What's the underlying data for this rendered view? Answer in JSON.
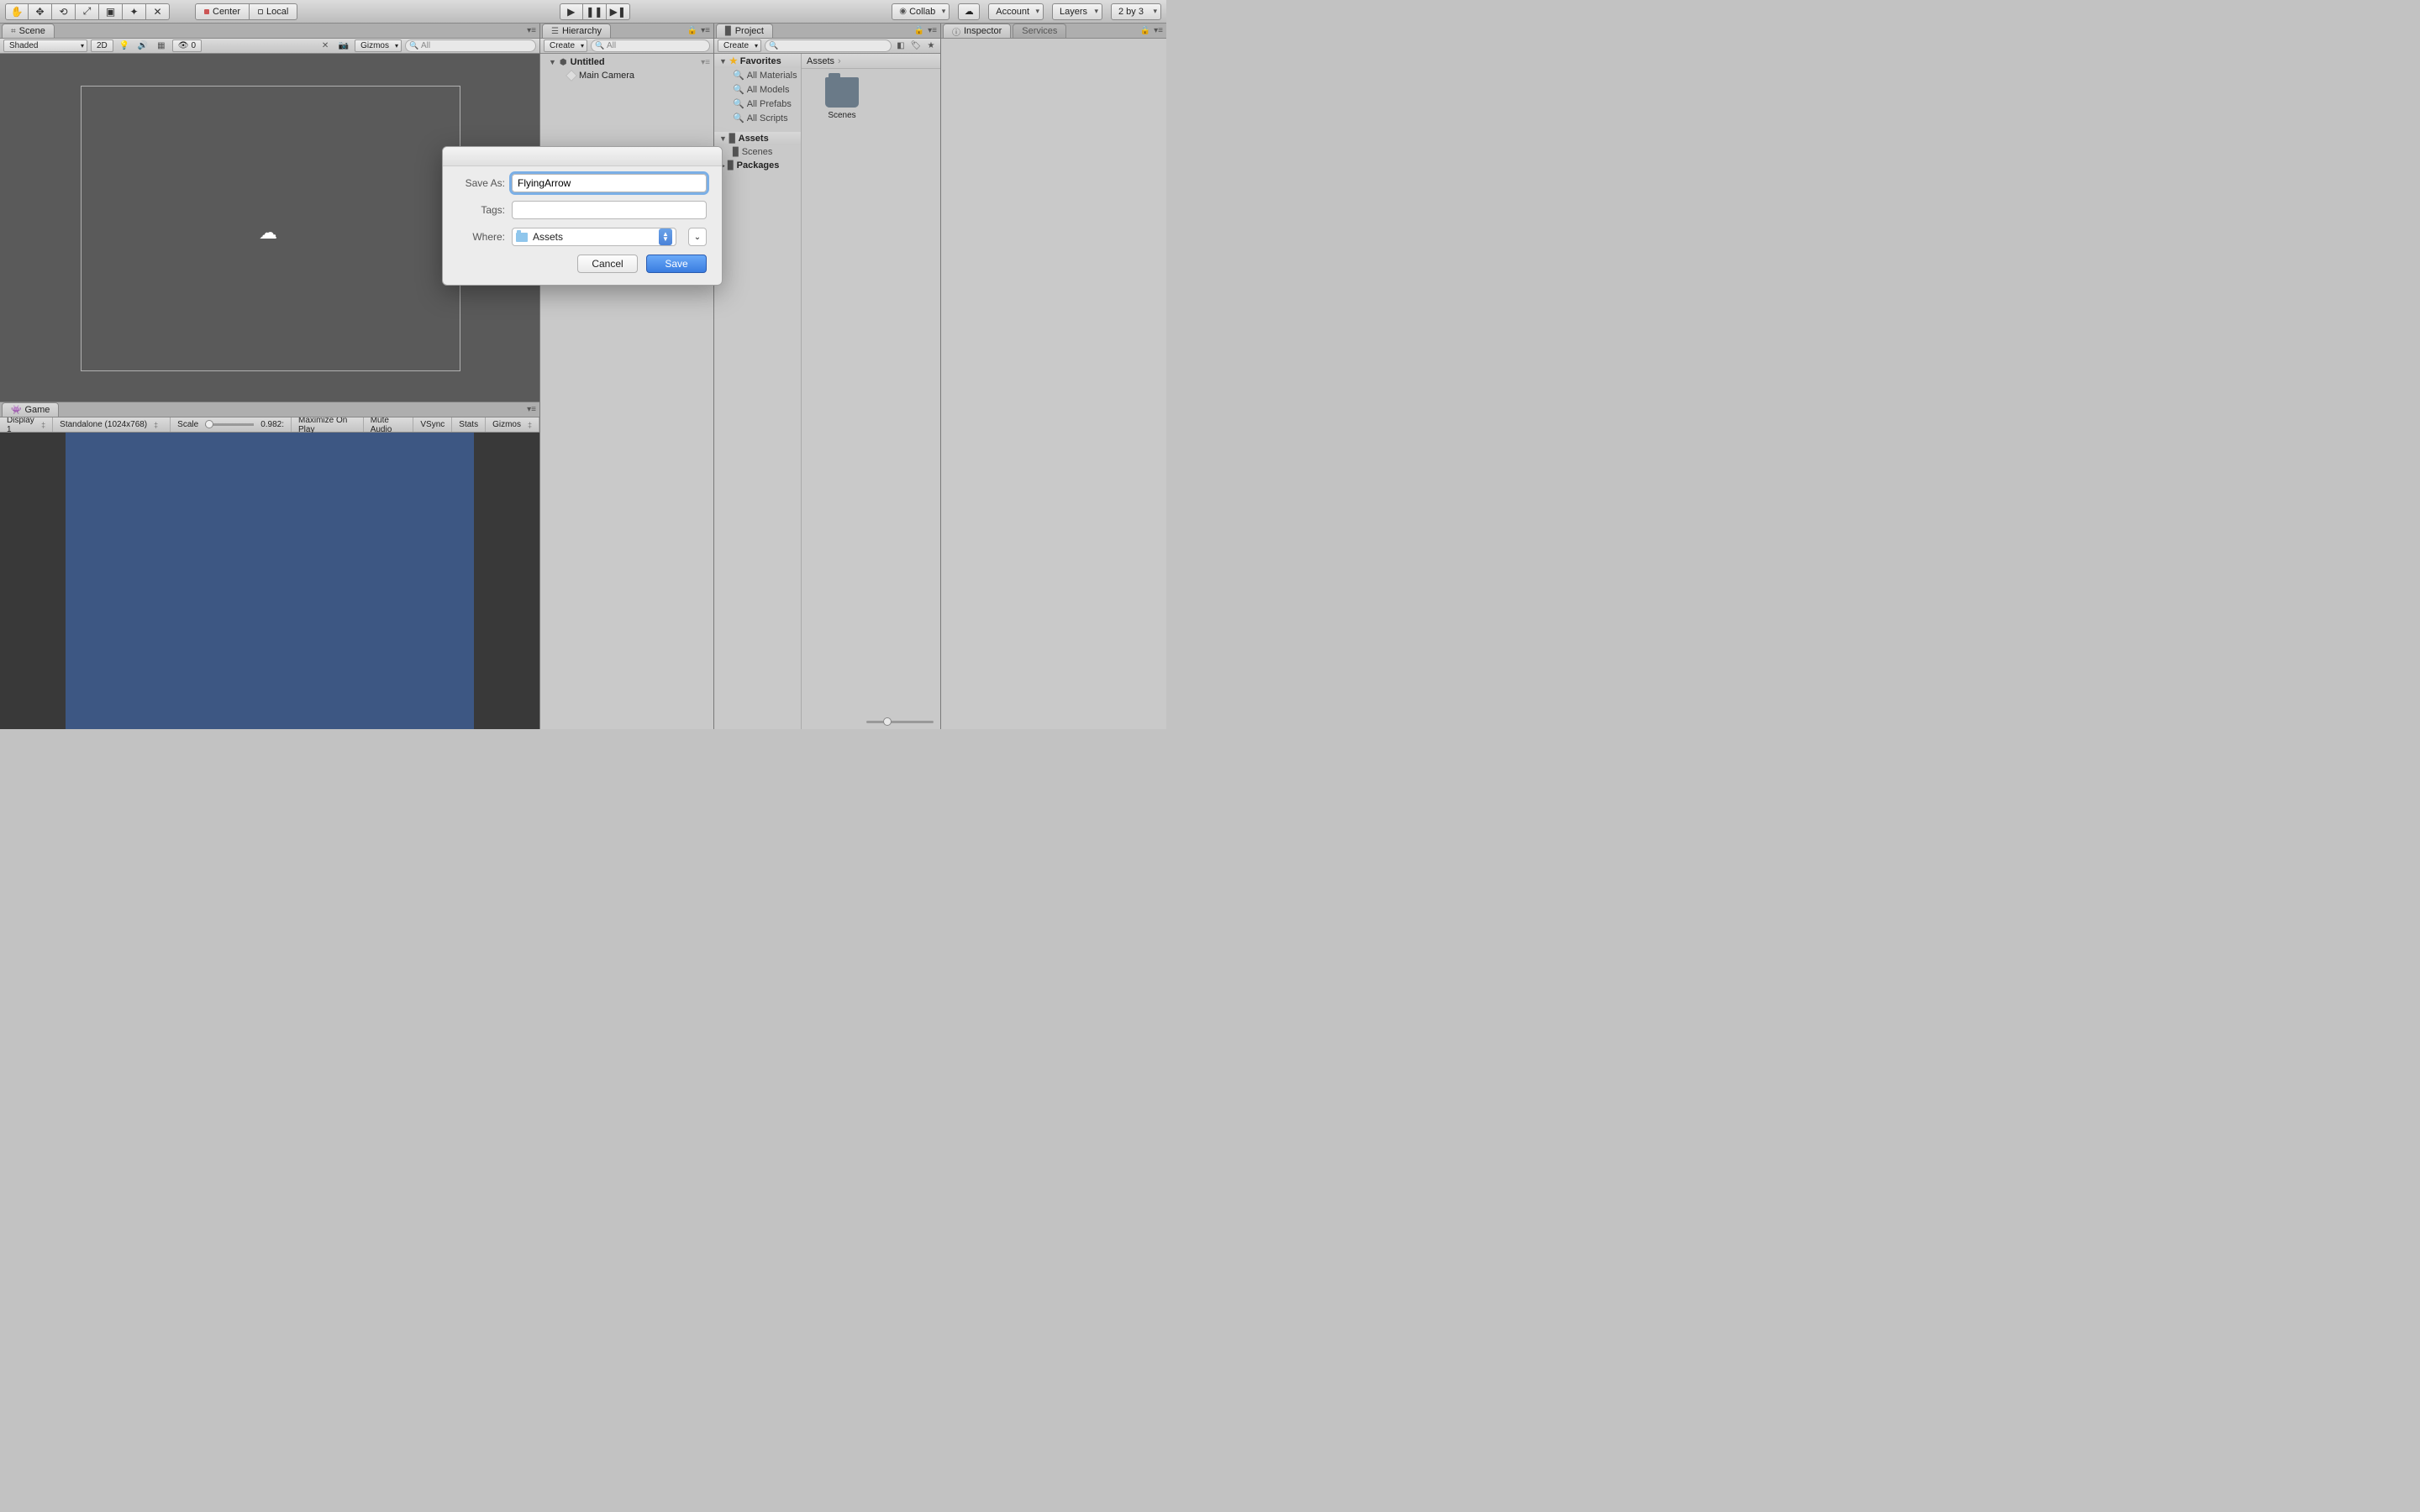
{
  "toolbar": {
    "center": "Center",
    "local": "Local",
    "collab": "Collab",
    "account": "Account",
    "layers": "Layers",
    "layout": "2 by 3"
  },
  "scene": {
    "tab": "Scene",
    "shaded": "Shaded",
    "mode2d": "2D",
    "gizmos": "Gizmos",
    "searchPlaceholder": "All",
    "zeroBadge": "0"
  },
  "game": {
    "tab": "Game",
    "display": "Display 1",
    "aspect": "Standalone (1024x768)",
    "scaleLabel": "Scale",
    "scaleValue": "0.982:",
    "maximize": "Maximize On Play",
    "mute": "Mute Audio",
    "vsync": "VSync",
    "stats": "Stats",
    "gizmos": "Gizmos"
  },
  "hierarchy": {
    "tab": "Hierarchy",
    "create": "Create",
    "searchPlaceholder": "All",
    "sceneName": "Untitled",
    "items": [
      "Main Camera"
    ]
  },
  "project": {
    "tab": "Project",
    "create": "Create",
    "favorites": "Favorites",
    "favItems": [
      "All Materials",
      "All Models",
      "All Prefabs",
      "All Scripts"
    ],
    "assets": "Assets",
    "assetsChildren": [
      "Scenes"
    ],
    "packages": "Packages",
    "breadcrumb": "Assets",
    "gridItems": [
      "Scenes"
    ]
  },
  "inspector": {
    "tab": "Inspector",
    "services": "Services"
  },
  "dialog": {
    "saveAsLabel": "Save As:",
    "saveAsValue": "FlyingArrow",
    "tagsLabel": "Tags:",
    "tagsValue": "",
    "whereLabel": "Where:",
    "whereValue": "Assets",
    "cancel": "Cancel",
    "save": "Save"
  }
}
